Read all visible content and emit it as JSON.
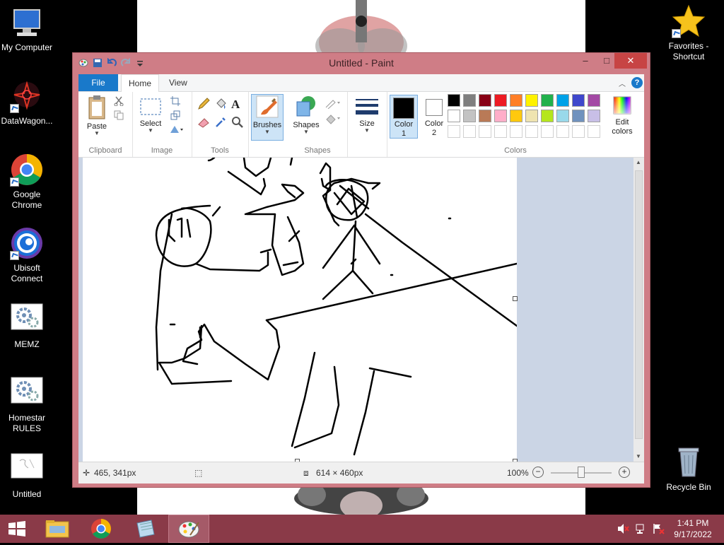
{
  "desktop": {
    "icons_left": [
      {
        "label": "My Computer",
        "icon": "computer-icon"
      },
      {
        "label": "DataWagon...",
        "icon": "datawagon-icon"
      },
      {
        "label": "Google Chrome",
        "icon": "chrome-icon"
      },
      {
        "label": "Ubisoft Connect",
        "icon": "ubisoft-icon"
      },
      {
        "label": "MEMZ",
        "icon": "settings-gear-icon"
      },
      {
        "label": "Homestar RULES",
        "icon": "settings-gear-icon"
      },
      {
        "label": "Untitled",
        "icon": "paint-file-icon"
      }
    ],
    "icons_right": [
      {
        "label": "Favorites - Shortcut",
        "icon": "star-icon"
      },
      {
        "label": "Recycle Bin",
        "icon": "recycle-bin-icon"
      }
    ]
  },
  "window": {
    "title": "Untitled - Paint",
    "minimize": "–",
    "maximize": "□",
    "close": "✕"
  },
  "tabs": {
    "file": "File",
    "home": "Home",
    "view": "View"
  },
  "ribbon": {
    "clipboard": {
      "label": "Clipboard",
      "paste": "Paste"
    },
    "image": {
      "label": "Image",
      "select": "Select"
    },
    "tools": {
      "label": "Tools"
    },
    "brushes": {
      "label": "Brushes"
    },
    "shapes": {
      "label": "Shapes",
      "shapes_btn": "Shapes"
    },
    "size": {
      "label": "Size"
    },
    "colors": {
      "label": "Colors",
      "color1": "Color 1",
      "color2": "Color 2",
      "edit": "Edit colors",
      "color1_value": "#000000",
      "color2_value": "#ffffff",
      "palette_row1": [
        "#000000",
        "#7f7f7f",
        "#880015",
        "#ed1c24",
        "#ff7f27",
        "#fff200",
        "#22b14c",
        "#00a2e8",
        "#3f48cc",
        "#a349a4"
      ],
      "palette_row2": [
        "#ffffff",
        "#c3c3c3",
        "#b97a57",
        "#ffaec9",
        "#ffc90e",
        "#efe4b0",
        "#b5e61d",
        "#99d9ea",
        "#7092be",
        "#c8bfe7"
      ]
    }
  },
  "status": {
    "cursor_pos": "465, 341px",
    "canvas_size": "614 × 460px",
    "zoom": "100%"
  },
  "tray": {
    "time": "1:41 PM",
    "date": "9/17/2022"
  },
  "accent": {
    "titlebar": "#cf7d86",
    "file_tab": "#1979ca",
    "taskbar": "#8a3a48"
  }
}
